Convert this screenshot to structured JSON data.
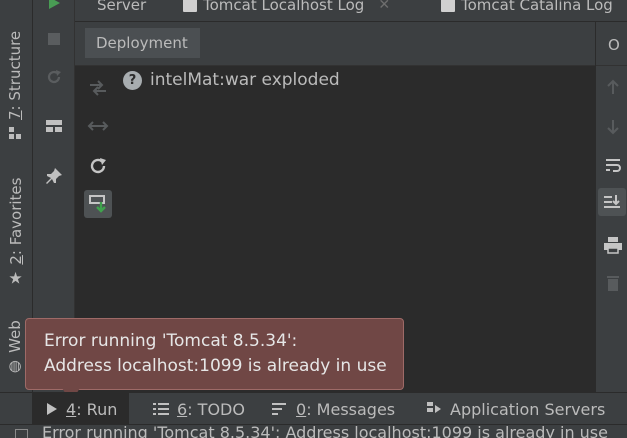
{
  "top_tabs": [
    {
      "label": "Server"
    },
    {
      "label": "Tomcat Localhost Log"
    },
    {
      "label": "Tomcat Catalina Log"
    }
  ],
  "left_strip": {
    "structure": {
      "num": "7",
      "label": ": Structure"
    },
    "favorites": {
      "num": "2",
      "label": ": Favorites"
    },
    "web": {
      "label": "Web"
    }
  },
  "deployment": {
    "title": "Deployment",
    "artifact": "intelMat:war exploded",
    "artifact_status_icon": "question-icon"
  },
  "output": {
    "title": "O"
  },
  "bottom_tabs": [
    {
      "num": "4",
      "label": ": Run"
    },
    {
      "num": "6",
      "label": ": TODO"
    },
    {
      "num": "0",
      "label": ": Messages"
    },
    {
      "label": "Application Servers"
    }
  ],
  "error_balloon": {
    "line1": "Error running 'Tomcat 8.5.34':",
    "line2": "Address localhost:1099 is already in use"
  },
  "status_bar": {
    "message": "Error running 'Tomcat 8.5.34': Address localhost:1099 is already in use"
  },
  "colors": {
    "background": "#3c3f41",
    "editor": "#2b2b2b",
    "run_green": "#499c54",
    "error_balloon": "#704745",
    "deploy_green": "#3fa34d"
  }
}
